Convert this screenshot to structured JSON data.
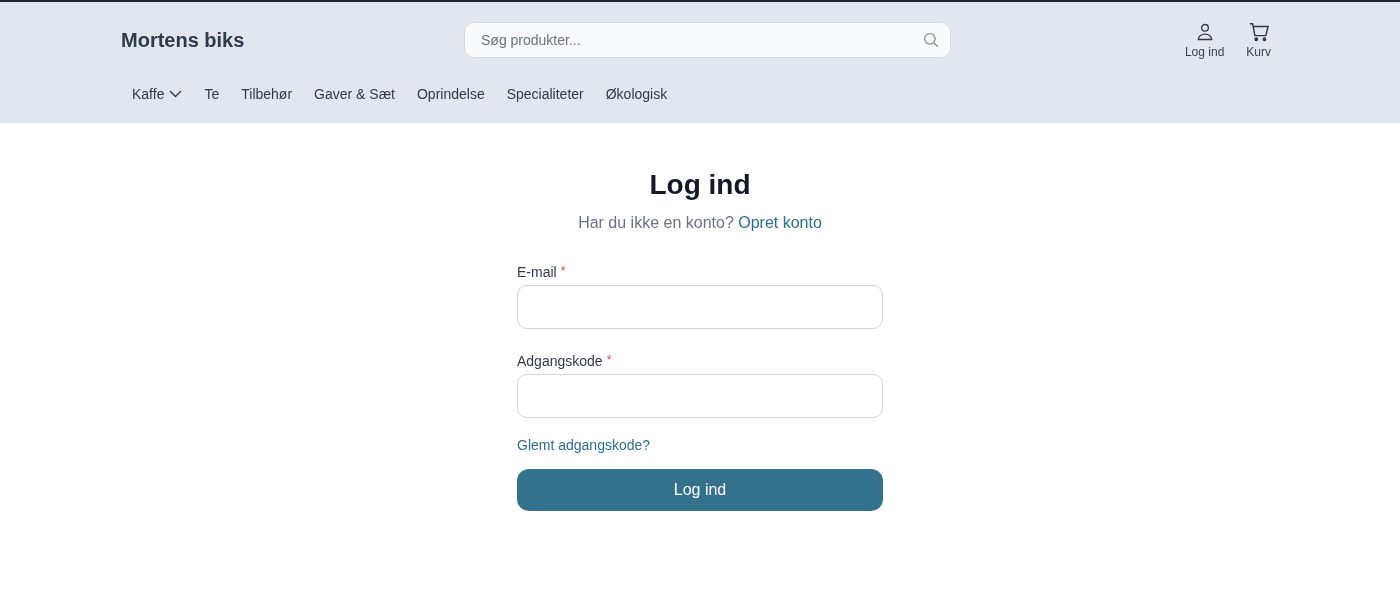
{
  "header": {
    "logo": "Mortens biks",
    "search": {
      "placeholder": "Søg produkter..."
    },
    "actions": [
      {
        "kind": "account",
        "label": "Log ind"
      },
      {
        "kind": "cart",
        "label": "Kurv"
      }
    ],
    "nav": [
      {
        "label": "Kaffe",
        "has_dropdown": true
      },
      {
        "label": "Te",
        "has_dropdown": false
      },
      {
        "label": "Tilbehør",
        "has_dropdown": false
      },
      {
        "label": "Gaver & Sæt",
        "has_dropdown": false
      },
      {
        "label": "Oprindelse",
        "has_dropdown": false
      },
      {
        "label": "Specialiteter",
        "has_dropdown": false
      },
      {
        "label": "Økologisk",
        "has_dropdown": false
      }
    ]
  },
  "login": {
    "title": "Log ind",
    "prompt": "Har du ikke en konto?",
    "signup_link": "Opret konto",
    "fields": [
      {
        "label": "E-mail",
        "required_mark": "*"
      },
      {
        "label": "Adgangskode",
        "required_mark": "*"
      }
    ],
    "forgot_link": "Glemt adgangskode?",
    "submit": "Log ind"
  }
}
